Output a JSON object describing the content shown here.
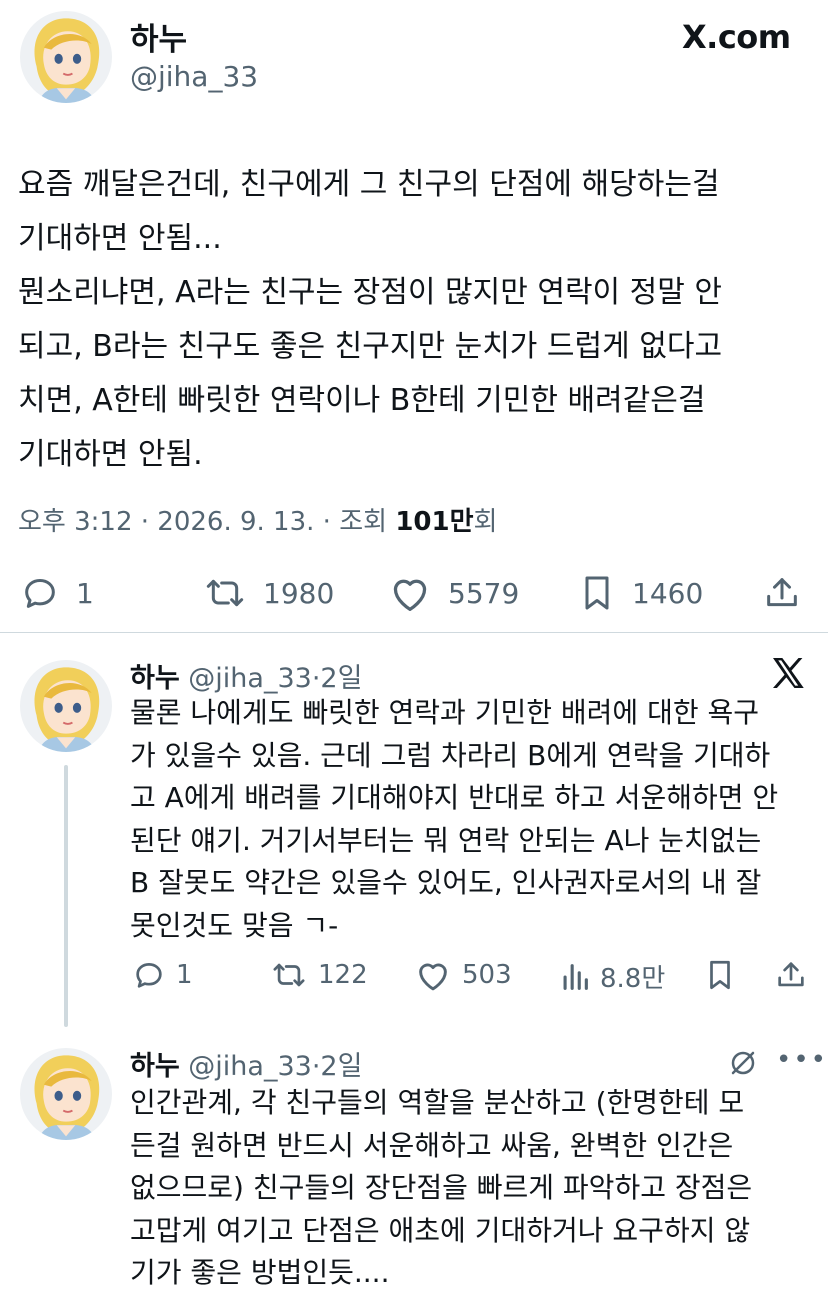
{
  "brand": {
    "logo": "X.com"
  },
  "main_post": {
    "author_name": "하누",
    "author_handle": "@jiha_33",
    "text_lines": [
      "요즘 깨달은건데, 친구에게 그 친구의 단점에 해당하는걸",
      "기대하면 안됨...",
      "뭔소리냐면, A라는 친구는 장점이 많지만 연락이 정말 안",
      "되고, B라는 친구도 좋은 친구지만 눈치가 드럽게 없다고",
      "치면, A한테 빠릿한 연락이나 B한테 기민한 배려같은걸",
      "기대하면 안됨."
    ],
    "timestamp": "오후 3:12 · 2026. 9. 13. · 조회 ",
    "views_value": "101만",
    "views_suffix": "회",
    "replies": "1",
    "reposts": "1980",
    "likes": "5579",
    "bookmarks": "1460"
  },
  "replies": [
    {
      "author_name": "하누",
      "author_handle": "@jiha_33",
      "time": "2일",
      "text_lines": [
        "물론 나에게도 빠릿한 연락과 기민한 배려에 대한 욕구",
        "가 있을수 있음. 근데 그럼 차라리 B에게 연락을 기대하",
        "고 A에게 배려를 기대해야지 반대로 하고 서운해하면 안",
        "된단 얘기. 거기서부터는 뭐 연락 안되는 A나 눈치없는",
        "B 잘못도 약간은 있을수 있어도, 인사권자로서의 내 잘",
        "못인것도 맞음 ㄱ-"
      ],
      "replies": "1",
      "reposts": "122",
      "likes": "503",
      "views": "8.8만"
    },
    {
      "author_name": "하누",
      "author_handle": "@jiha_33",
      "time": "2일",
      "text_lines": [
        "인간관계, 각 친구들의 역할을 분산하고 (한명한테 모",
        "든걸 원하면 반드시 서운해하고 싸움, 완벽한 인간은",
        "없으므로) 친구들의 장단점을 빠르게 파악하고 장점은",
        "고맙게 여기고 단점은 애초에 기대하거나 요구하지 않",
        "기가 좋은 방법인듯...."
      ]
    }
  ],
  "colors": {
    "text": "#0f1419",
    "secondary": "#536471",
    "divider": "#cfd9de"
  }
}
